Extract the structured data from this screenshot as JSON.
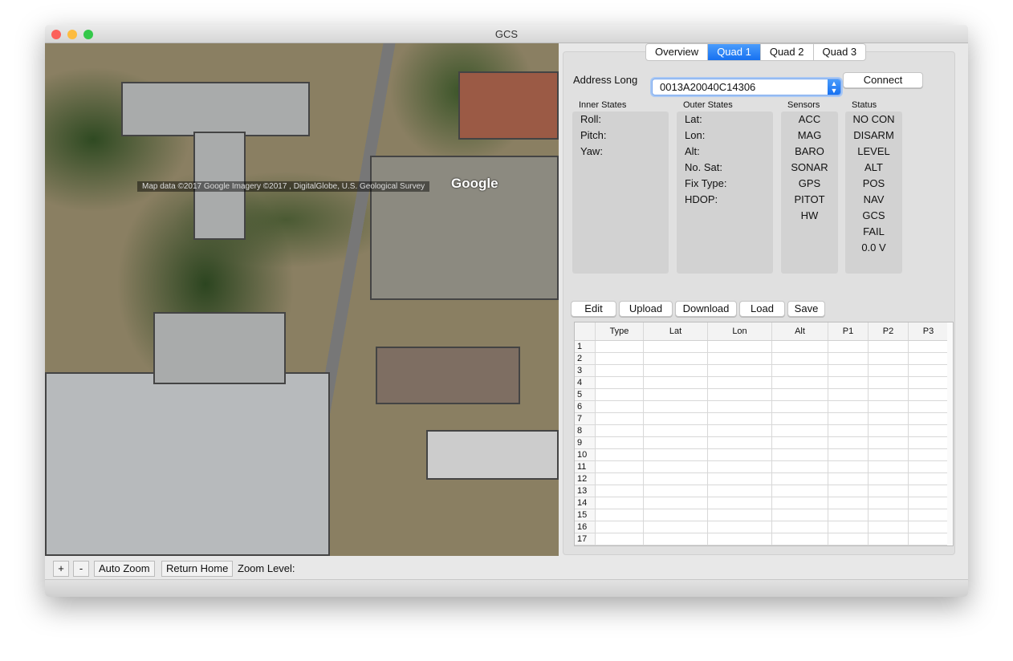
{
  "window": {
    "title": "GCS"
  },
  "map": {
    "attribution": "Map data ©2017 Google  Imagery ©2017 , DigitalGlobe, U.S. Geological Survey",
    "logo": "Google"
  },
  "tabs": [
    {
      "label": "Overview",
      "active": false
    },
    {
      "label": "Quad 1",
      "active": true
    },
    {
      "label": "Quad 2",
      "active": false
    },
    {
      "label": "Quad 3",
      "active": false
    }
  ],
  "address": {
    "label": "Address Long",
    "value": "0013A20040C14306",
    "connect_label": "Connect"
  },
  "inner_states": {
    "title": "Inner States",
    "items": [
      "Roll:",
      "Pitch:",
      "Yaw:"
    ]
  },
  "outer_states": {
    "title": "Outer States",
    "items": [
      "Lat:",
      "Lon:",
      "Alt:",
      "No. Sat:",
      "Fix Type:",
      "HDOP:"
    ]
  },
  "sensors": {
    "title": "Sensors",
    "items": [
      "ACC",
      "MAG",
      "BARO",
      "SONAR",
      "GPS",
      "PITOT",
      "HW"
    ]
  },
  "status": {
    "title": "Status",
    "items": [
      "NO CON",
      "DISARM",
      "LEVEL",
      "ALT",
      "POS",
      "NAV",
      "GCS",
      "FAIL",
      "0.0 V"
    ]
  },
  "mission_buttons": [
    "Edit",
    "Upload",
    "Download",
    "Load",
    "Save"
  ],
  "table": {
    "columns": [
      "Type",
      "Lat",
      "Lon",
      "Alt",
      "P1",
      "P2",
      "P3"
    ],
    "rows": [
      "1",
      "2",
      "3",
      "4",
      "5",
      "6",
      "7",
      "8",
      "9",
      "10",
      "11",
      "12",
      "13",
      "14",
      "15",
      "16",
      "17"
    ]
  },
  "bottom": {
    "zoom_in": "+",
    "zoom_out": "-",
    "auto_zoom": "Auto Zoom",
    "return_home": "Return Home",
    "zoom_level_label": "Zoom Level:"
  }
}
